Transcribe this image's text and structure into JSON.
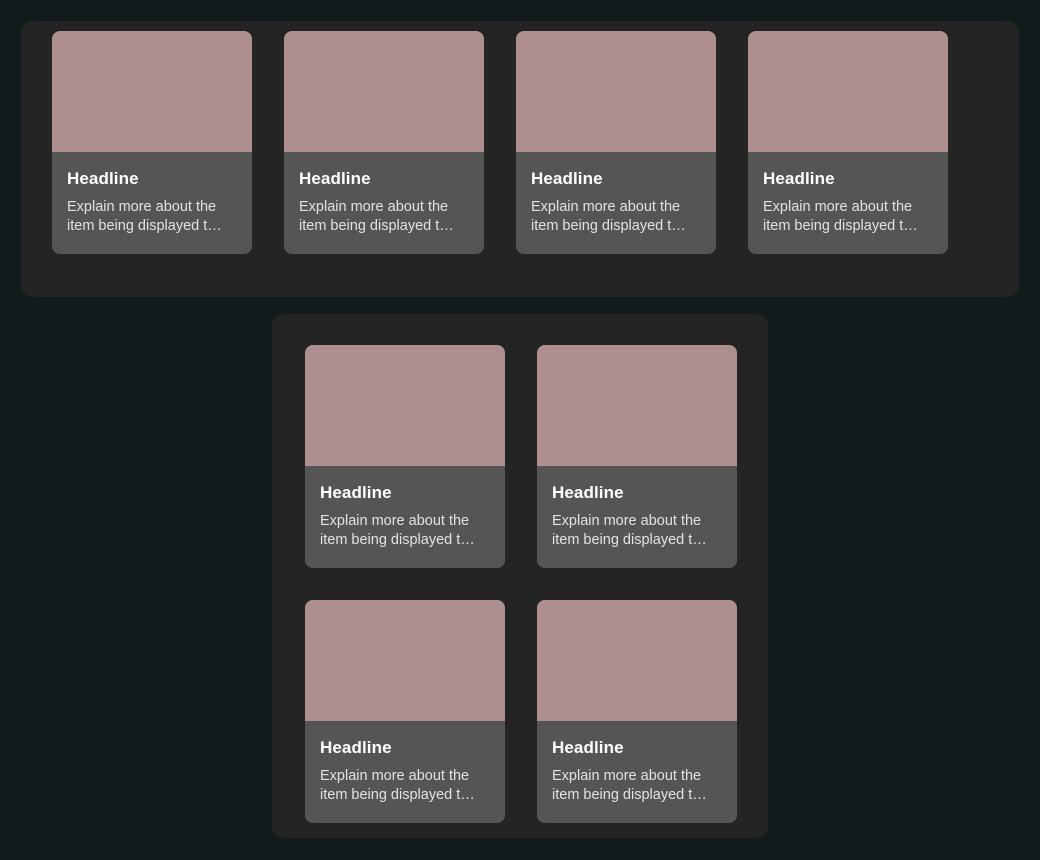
{
  "theme": {
    "page_background": "#131a1c",
    "panel_background": "#242424",
    "card_body_background": "#555555",
    "card_media_background": "#ad8f91",
    "title_color": "#ffffff",
    "description_color": "#e2e2e2"
  },
  "card_defaults": {
    "title": "Headline",
    "description": "Explain more about the item being displayed t…"
  },
  "panels": [
    {
      "name": "top-card-panel",
      "columns": 4,
      "cards": [
        {
          "title": "Headline",
          "description": "Explain more about the item being displayed t…"
        },
        {
          "title": "Headline",
          "description": "Explain more about the item being displayed t…"
        },
        {
          "title": "Headline",
          "description": "Explain more about the item being displayed t…"
        },
        {
          "title": "Headline",
          "description": "Explain more about the item being displayed t…"
        }
      ]
    },
    {
      "name": "bottom-card-panel",
      "columns": 2,
      "cards": [
        {
          "title": "Headline",
          "description": "Explain more about the item being displayed t…"
        },
        {
          "title": "Headline",
          "description": "Explain more about the item being displayed t…"
        },
        {
          "title": "Headline",
          "description": "Explain more about the item being displayed t…"
        },
        {
          "title": "Headline",
          "description": "Explain more about the item being displayed t…"
        }
      ]
    }
  ]
}
